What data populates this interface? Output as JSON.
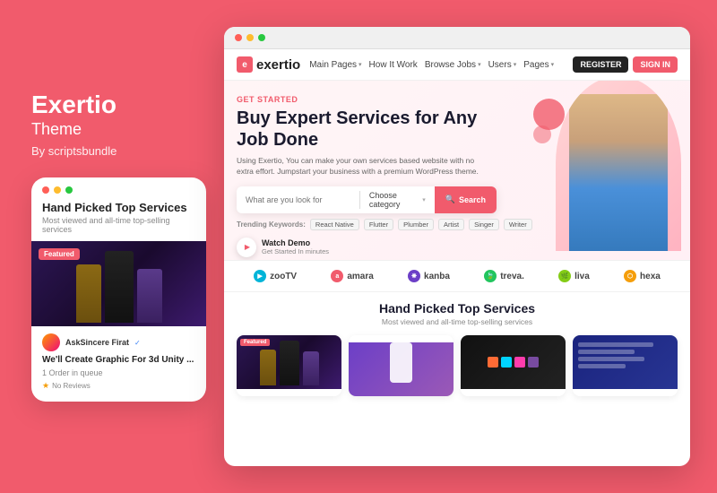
{
  "brand": {
    "name": "Exertio",
    "subtitle": "Theme",
    "by": "By scriptsbundle"
  },
  "mobile_card": {
    "title": "Hand Picked Top Services",
    "subtitle": "Most viewed and all-time top-selling services",
    "featured_badge": "Featured",
    "user_name": "AskSincere Firat",
    "service_title": "We'll Create Graphic For 3d Unity ...",
    "orders": "1 Order in queue",
    "rating": "No Reviews",
    "dots": [
      "red",
      "yellow",
      "green"
    ]
  },
  "browser": {
    "dots": [
      "red",
      "yellow",
      "green"
    ]
  },
  "navbar": {
    "logo": "exertio",
    "logo_icon": "e",
    "links": [
      "Main Pages",
      "How It Work",
      "Browse Jobs",
      "Users",
      "Pages"
    ],
    "btn_register": "REGISTER",
    "btn_signin": "SIGN IN"
  },
  "hero": {
    "tag": "GET STARTED",
    "title": "Buy Expert Services for Any Job Done",
    "description": "Using Exertio, You can make your own services based website with no extra effort. Jumpstart your business with a premium WordPress theme.",
    "search_placeholder": "What are you look for",
    "category_placeholder": "Choose category",
    "search_btn": "Search",
    "trending_label": "Trending Keywords:",
    "trending_tags": [
      "React Native",
      "Flutter",
      "Plumber",
      "Artist",
      "Singer",
      "Writer"
    ],
    "watch_title": "Watch Demo",
    "watch_sub": "Get Started In minutes"
  },
  "logos": [
    {
      "name": "zooTV",
      "icon": "🎬",
      "color": "#00b4d8"
    },
    {
      "name": "amara",
      "icon": "a",
      "color": "#f15b6c"
    },
    {
      "name": "kanba",
      "icon": "k",
      "color": "#6c3fc7"
    },
    {
      "name": "treva.",
      "icon": "t",
      "color": "#22c55e"
    },
    {
      "name": "liva",
      "icon": "l",
      "color": "#84cc16"
    },
    {
      "name": "hexa",
      "icon": "⬡",
      "color": "#f59e0b"
    }
  ],
  "bottom_section": {
    "title": "Hand Picked Top Services",
    "subtitle": "Most viewed and all-time top-selling services",
    "featured_badge": "Featured"
  },
  "colors": {
    "brand_red": "#f15b6c",
    "dark_nav": "#1a1a2e"
  }
}
